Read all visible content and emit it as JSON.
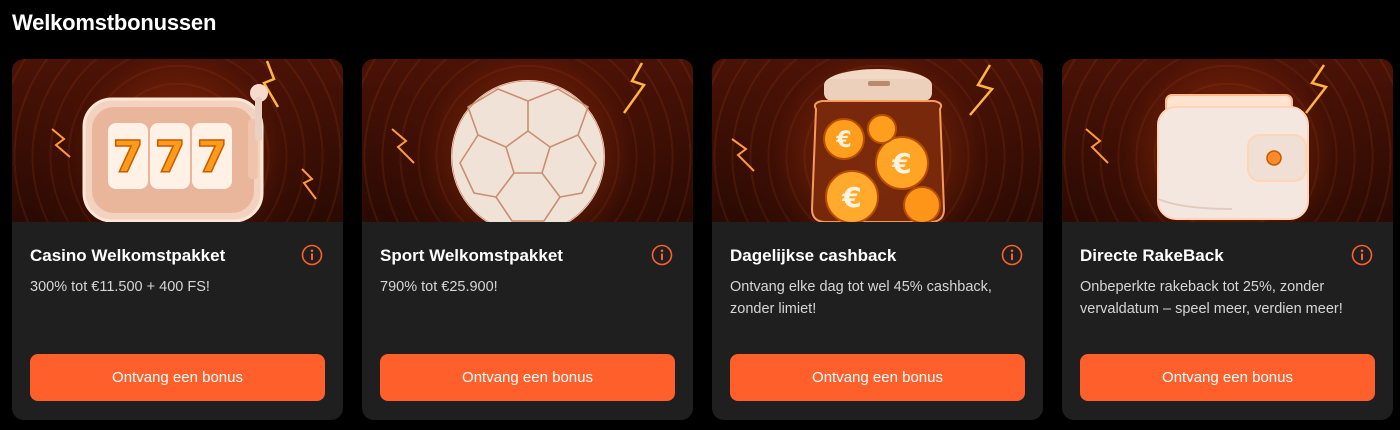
{
  "section": {
    "title": "Welkomstbonussen"
  },
  "colors": {
    "accent": "#ff5f2a",
    "card_bg": "#1f1f1f",
    "page_bg": "#000000"
  },
  "cards": [
    {
      "title": "Casino Welkomstpakket",
      "description": "300% tot €11.500 + 400 FS!",
      "button_label": "Ontvang een bonus",
      "art": "slot-machine-777-icon",
      "reels": [
        "7",
        "7",
        "7"
      ]
    },
    {
      "title": "Sport Welkomstpakket",
      "description": "790% tot €25.900!",
      "button_label": "Ontvang een bonus",
      "art": "soccer-ball-icon"
    },
    {
      "title": "Dagelijkse cashback",
      "description": "Ontvang elke dag tot wel 45% cashback, zonder limiet!",
      "button_label": "Ontvang een bonus",
      "art": "euro-coin-jar-icon"
    },
    {
      "title": "Directe RakeBack",
      "description": "Onbeperkte rakeback tot 25%, zonder vervaldatum – speel meer, verdien meer!",
      "button_label": "Ontvang een bonus",
      "art": "wallet-icon"
    }
  ]
}
